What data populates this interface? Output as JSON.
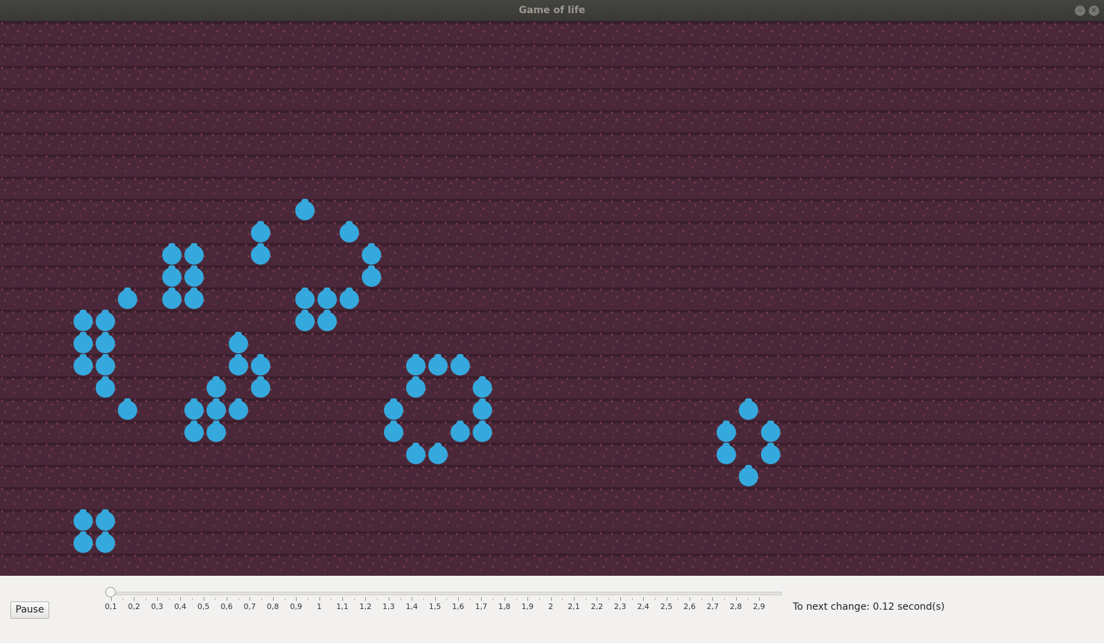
{
  "window": {
    "title": "Game of life"
  },
  "board": {
    "cell_color": "#35a9dd",
    "background_color": "#4a2839",
    "live_cells": [
      [
        13,
        8
      ],
      [
        11,
        9
      ],
      [
        15,
        9
      ],
      [
        7,
        10
      ],
      [
        8,
        10
      ],
      [
        11,
        10
      ],
      [
        16,
        10
      ],
      [
        7,
        11
      ],
      [
        8,
        11
      ],
      [
        16,
        11
      ],
      [
        5,
        12
      ],
      [
        7,
        12
      ],
      [
        8,
        12
      ],
      [
        13,
        12
      ],
      [
        14,
        12
      ],
      [
        15,
        12
      ],
      [
        3,
        13
      ],
      [
        4,
        13
      ],
      [
        13,
        13
      ],
      [
        14,
        13
      ],
      [
        3,
        14
      ],
      [
        4,
        14
      ],
      [
        10,
        14
      ],
      [
        3,
        15
      ],
      [
        4,
        15
      ],
      [
        10,
        15
      ],
      [
        11,
        15
      ],
      [
        18,
        15
      ],
      [
        19,
        15
      ],
      [
        20,
        15
      ],
      [
        4,
        16
      ],
      [
        9,
        16
      ],
      [
        11,
        16
      ],
      [
        18,
        16
      ],
      [
        21,
        16
      ],
      [
        5,
        17
      ],
      [
        8,
        17
      ],
      [
        9,
        17
      ],
      [
        10,
        17
      ],
      [
        17,
        17
      ],
      [
        21,
        17
      ],
      [
        33,
        17
      ],
      [
        8,
        18
      ],
      [
        9,
        18
      ],
      [
        17,
        18
      ],
      [
        20,
        18
      ],
      [
        21,
        18
      ],
      [
        32,
        18
      ],
      [
        34,
        18
      ],
      [
        18,
        19
      ],
      [
        19,
        19
      ],
      [
        32,
        19
      ],
      [
        34,
        19
      ],
      [
        33,
        20
      ],
      [
        3,
        22
      ],
      [
        4,
        22
      ],
      [
        3,
        23
      ],
      [
        4,
        23
      ]
    ]
  },
  "controls": {
    "pause_label": "Pause",
    "speed_min": 0.1,
    "speed_max": 3.0,
    "speed_value": 0.1,
    "tick_labels": [
      "0,1",
      "0,2",
      "0,3",
      "0,4",
      "0,5",
      "0,6",
      "0,7",
      "0,8",
      "0,9",
      "1",
      "1,1",
      "1,2",
      "1,3",
      "1,4",
      "1,5",
      "1,6",
      "1,7",
      "1,8",
      "1,9",
      "2",
      "2,1",
      "2,2",
      "2,3",
      "2,4",
      "2,5",
      "2,6",
      "2,7",
      "2,8",
      "2,9"
    ],
    "status_text": "To next change: 0.12 second(s)"
  }
}
